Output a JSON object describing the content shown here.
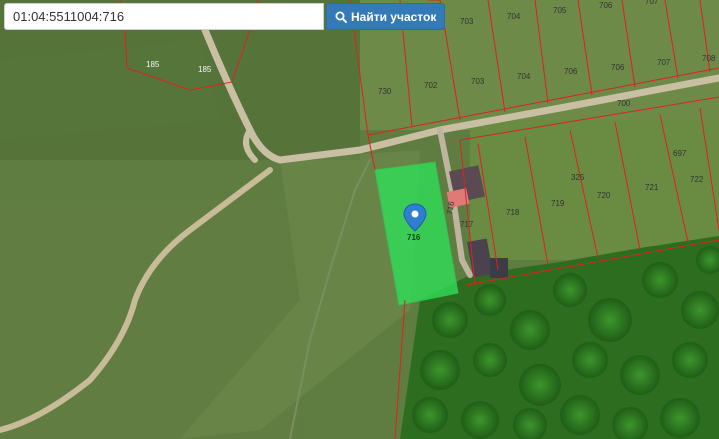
{
  "search": {
    "value": "01:04:5511004:716",
    "button_label": "Найти участок",
    "button_icon": "search-icon"
  },
  "map": {
    "type": "satellite",
    "parcel_outline_color": "#e02020",
    "selected_parcel_color": "#2ee05a",
    "marker_color": "#2f7fd0",
    "selected_parcel": {
      "number": "716",
      "marker_label": "716"
    },
    "plot_labels": {
      "p185a": "185",
      "p185b": "185",
      "p703a": "703",
      "p704a": "704",
      "p705": "705",
      "p706a": "706",
      "p707a": "707",
      "p730": "730",
      "p702": "702",
      "p703b": "703",
      "p704b": "704",
      "p706b": "706",
      "p706c": "706",
      "p707b": "707",
      "p708": "708",
      "p700": "700",
      "p697": "697",
      "p325": "325",
      "p720": "720",
      "p721": "721",
      "p722": "722",
      "p719": "719",
      "p718": "718",
      "p717": "717",
      "p716b": "716"
    }
  }
}
